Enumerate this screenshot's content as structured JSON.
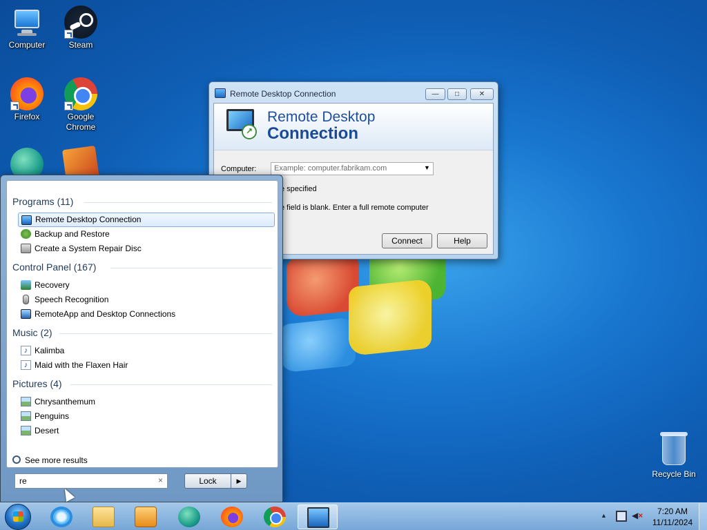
{
  "desktop": {
    "icons": [
      {
        "label": "Computer"
      },
      {
        "label": "Steam"
      },
      {
        "label": "Firefox"
      },
      {
        "label": "Google Chrome"
      }
    ],
    "recycle_bin": "Recycle Bin"
  },
  "rdc_window": {
    "title": "Remote Desktop Connection",
    "banner_line1": "Remote Desktop",
    "banner_line2": "Connection",
    "computer_label": "Computer:",
    "computer_placeholder": "Example: computer.fabrikam.com",
    "status_text": "e specified",
    "info_text": "e field is blank. Enter a full remote computer",
    "connect_button": "Connect",
    "help_button": "Help"
  },
  "start_menu": {
    "groups": [
      {
        "title": "Programs (11)",
        "items": [
          "Remote Desktop Connection",
          "Backup and Restore",
          "Create a System Repair Disc"
        ]
      },
      {
        "title": "Control Panel (167)",
        "items": [
          "Recovery",
          "Speech Recognition",
          "RemoteApp and Desktop Connections"
        ]
      },
      {
        "title": "Music (2)",
        "items": [
          "Kalimba",
          "Maid with the Flaxen Hair"
        ]
      },
      {
        "title": "Pictures (4)",
        "items": [
          "Chrysanthemum",
          "Penguins",
          "Desert"
        ]
      }
    ],
    "see_more": "See more results",
    "search_value": "re",
    "lock_button": "Lock"
  },
  "taskbar": {
    "clock_time": "7:20 AM",
    "clock_date": "11/11/2024"
  },
  "icons": {
    "clear_search": "×",
    "lock_arrow": "▶",
    "dropdown": "▼",
    "tray_up": "▲",
    "volume_muted": "×",
    "minimize": "—",
    "maximize": "□",
    "close": "✕"
  }
}
